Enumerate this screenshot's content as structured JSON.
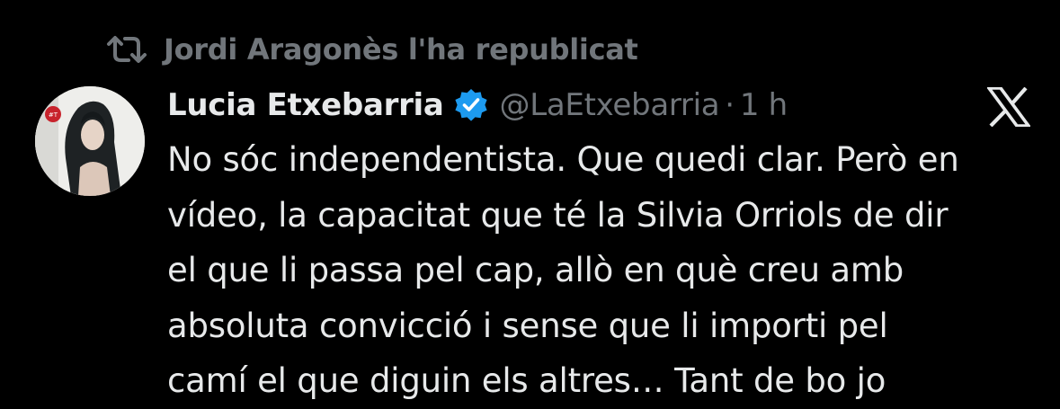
{
  "repost": {
    "icon": "repost-icon",
    "text": "Jordi Aragonès l'ha republicat"
  },
  "tweet": {
    "author_name": "Lucia Etxebarria",
    "verified_icon": "verified-badge-icon",
    "verified_color": "#1d9bf0",
    "handle": "@LaEtxebarria",
    "separator": "·",
    "time": "1 h",
    "platform_icon": "x-logo-icon",
    "body": "No sóc independentista. Que quedi clar. Però en\nvídeo, la capacitat que té la Silvia Orriols de dir\nel que li passa pel cap, allò en què creu amb\nabsoluta convicció i sense que li importi pel\ncamí el que diguin els altres… Tant de bo jo"
  },
  "colors": {
    "background": "#000000",
    "primary_text": "#e7e9ea",
    "secondary_text": "#71767b",
    "accent": "#1d9bf0"
  }
}
